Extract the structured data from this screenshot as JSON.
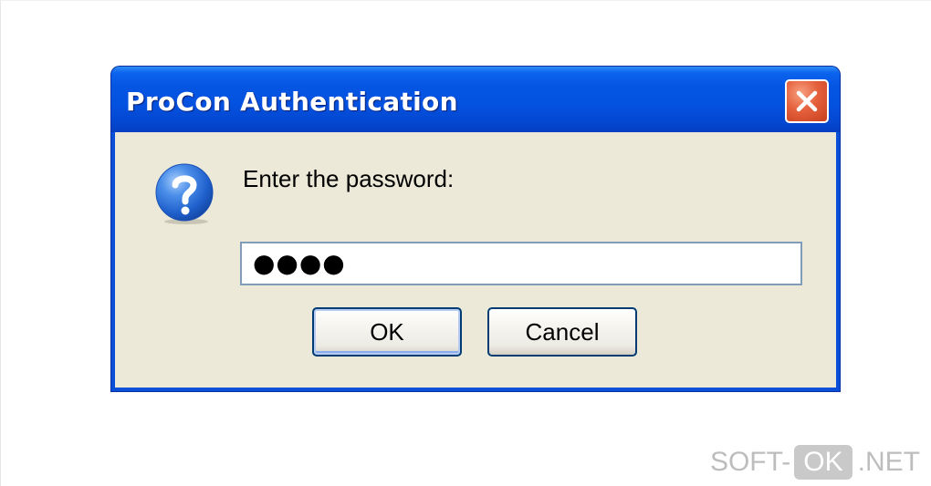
{
  "window": {
    "title": "ProCon Authentication",
    "close_icon": "close-x-icon"
  },
  "dialog": {
    "icon": "question-icon",
    "prompt": "Enter the password:",
    "password_value": "●●●●",
    "ok_label": "OK",
    "cancel_label": "Cancel"
  },
  "watermark": {
    "prefix": "SOFT-",
    "highlight": "OK",
    "suffix": ".NET"
  },
  "colors": {
    "titlebar_blue": "#0555e3",
    "client_bg": "#ece9d8",
    "close_red": "#e5603c",
    "question_blue": "#2a73d9"
  }
}
